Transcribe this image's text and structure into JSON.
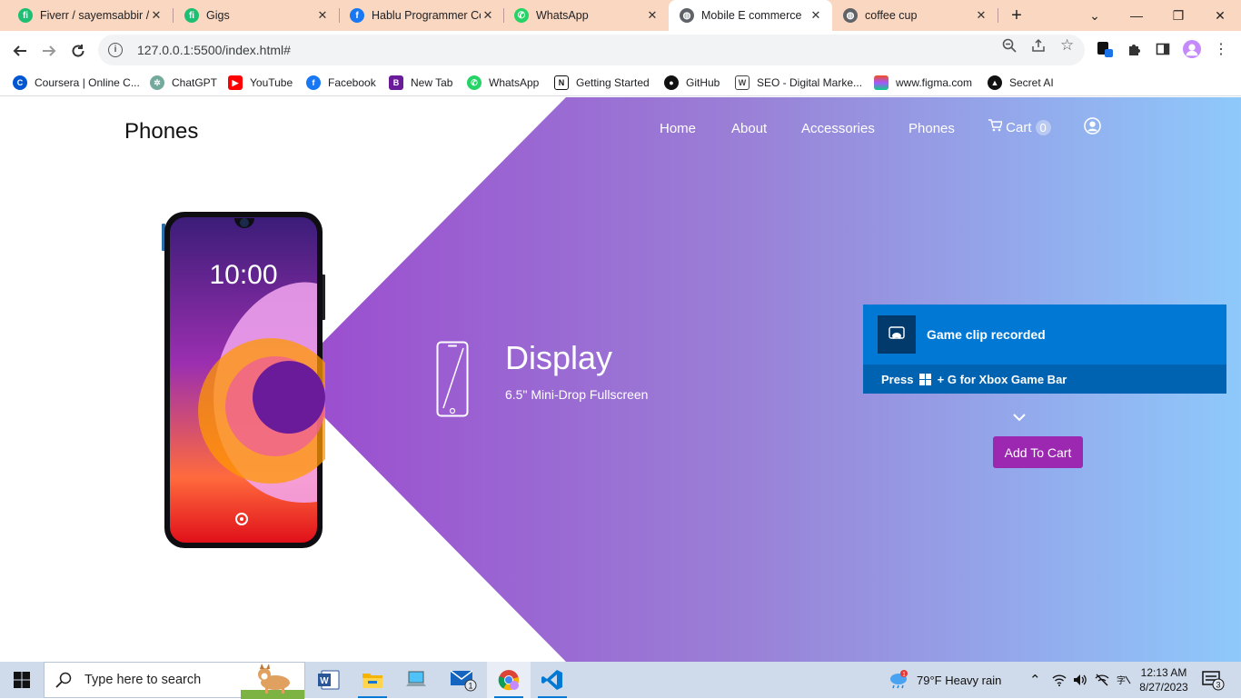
{
  "browser": {
    "tabs": [
      {
        "label": "Fiverr / sayemsabbir /",
        "icon": "fiverr-icon",
        "color": "#1dbf73"
      },
      {
        "label": "Gigs",
        "icon": "fiverr-icon",
        "color": "#1dbf73"
      },
      {
        "label": "Hablu Programmer Co",
        "icon": "facebook-icon",
        "color": "#1877f2"
      },
      {
        "label": "WhatsApp",
        "icon": "whatsapp-icon",
        "color": "#25d366"
      },
      {
        "label": "Mobile E commerce",
        "icon": "globe-icon",
        "color": "#5f6368",
        "active": true
      },
      {
        "label": "coffee cup",
        "icon": "globe-icon",
        "color": "#5f6368"
      }
    ],
    "url": "127.0.0.1:5500/index.html#",
    "bookmarks": [
      {
        "label": "Coursera | Online C...",
        "icon": "coursera-icon",
        "color": "#0056d2"
      },
      {
        "label": "ChatGPT",
        "icon": "chatgpt-icon",
        "color": "#74aa9c"
      },
      {
        "label": "YouTube",
        "icon": "youtube-icon",
        "color": "#ff0000"
      },
      {
        "label": "Facebook",
        "icon": "facebook-icon",
        "color": "#1877f2"
      },
      {
        "label": "New Tab",
        "icon": "newtab-icon",
        "color": "#6a1b9a"
      },
      {
        "label": "WhatsApp",
        "icon": "whatsapp-icon",
        "color": "#25d366"
      },
      {
        "label": "Getting Started",
        "icon": "notion-icon",
        "color": "#111111"
      },
      {
        "label": "GitHub",
        "icon": "github-icon",
        "color": "#111111"
      },
      {
        "label": "SEO - Digital Marke...",
        "icon": "webpage-icon",
        "color": "#444444"
      },
      {
        "label": "www.figma.com",
        "icon": "figma-icon",
        "color": "#f24e1e"
      },
      {
        "label": "Secret AI",
        "icon": "secret-ai-icon",
        "color": "#111111"
      }
    ]
  },
  "site": {
    "brand": "Phones",
    "nav": [
      "Home",
      "About",
      "Accessories",
      "Phones"
    ],
    "cart_label": "Cart",
    "cart_count": "0",
    "phone_screen_time": "10:00",
    "feature_title": "Display",
    "feature_subtitle": "6.5\" Mini-Drop Fullscreen",
    "add_to_cart": "Add To Cart",
    "gradient_colors": [
      "#9b59d0",
      "#90caf9"
    ]
  },
  "toast": {
    "title": "Game clip recorded",
    "hint_prefix": "Press",
    "hint_suffix": "+ G for Xbox Game Bar"
  },
  "taskbar": {
    "search_placeholder": "Type here to search",
    "weather": "79°F  Heavy rain",
    "time": "12:13 AM",
    "date": "8/27/2023",
    "notification_count": "3",
    "mail_badge": "1"
  }
}
